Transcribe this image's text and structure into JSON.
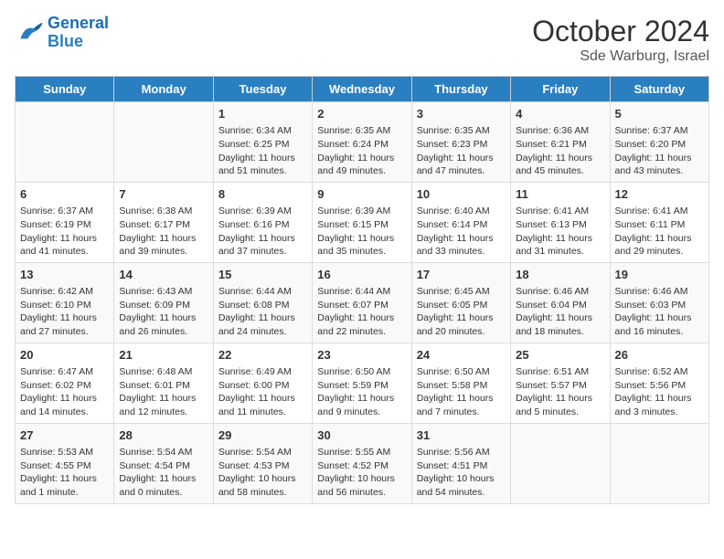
{
  "logo": {
    "text_general": "General",
    "text_blue": "Blue"
  },
  "header": {
    "month": "October 2024",
    "location": "Sde Warburg, Israel"
  },
  "days_of_week": [
    "Sunday",
    "Monday",
    "Tuesday",
    "Wednesday",
    "Thursday",
    "Friday",
    "Saturday"
  ],
  "weeks": [
    [
      {
        "day": "",
        "info": ""
      },
      {
        "day": "",
        "info": ""
      },
      {
        "day": "1",
        "info": "Sunrise: 6:34 AM\nSunset: 6:25 PM\nDaylight: 11 hours and 51 minutes."
      },
      {
        "day": "2",
        "info": "Sunrise: 6:35 AM\nSunset: 6:24 PM\nDaylight: 11 hours and 49 minutes."
      },
      {
        "day": "3",
        "info": "Sunrise: 6:35 AM\nSunset: 6:23 PM\nDaylight: 11 hours and 47 minutes."
      },
      {
        "day": "4",
        "info": "Sunrise: 6:36 AM\nSunset: 6:21 PM\nDaylight: 11 hours and 45 minutes."
      },
      {
        "day": "5",
        "info": "Sunrise: 6:37 AM\nSunset: 6:20 PM\nDaylight: 11 hours and 43 minutes."
      }
    ],
    [
      {
        "day": "6",
        "info": "Sunrise: 6:37 AM\nSunset: 6:19 PM\nDaylight: 11 hours and 41 minutes."
      },
      {
        "day": "7",
        "info": "Sunrise: 6:38 AM\nSunset: 6:17 PM\nDaylight: 11 hours and 39 minutes."
      },
      {
        "day": "8",
        "info": "Sunrise: 6:39 AM\nSunset: 6:16 PM\nDaylight: 11 hours and 37 minutes."
      },
      {
        "day": "9",
        "info": "Sunrise: 6:39 AM\nSunset: 6:15 PM\nDaylight: 11 hours and 35 minutes."
      },
      {
        "day": "10",
        "info": "Sunrise: 6:40 AM\nSunset: 6:14 PM\nDaylight: 11 hours and 33 minutes."
      },
      {
        "day": "11",
        "info": "Sunrise: 6:41 AM\nSunset: 6:13 PM\nDaylight: 11 hours and 31 minutes."
      },
      {
        "day": "12",
        "info": "Sunrise: 6:41 AM\nSunset: 6:11 PM\nDaylight: 11 hours and 29 minutes."
      }
    ],
    [
      {
        "day": "13",
        "info": "Sunrise: 6:42 AM\nSunset: 6:10 PM\nDaylight: 11 hours and 27 minutes."
      },
      {
        "day": "14",
        "info": "Sunrise: 6:43 AM\nSunset: 6:09 PM\nDaylight: 11 hours and 26 minutes."
      },
      {
        "day": "15",
        "info": "Sunrise: 6:44 AM\nSunset: 6:08 PM\nDaylight: 11 hours and 24 minutes."
      },
      {
        "day": "16",
        "info": "Sunrise: 6:44 AM\nSunset: 6:07 PM\nDaylight: 11 hours and 22 minutes."
      },
      {
        "day": "17",
        "info": "Sunrise: 6:45 AM\nSunset: 6:05 PM\nDaylight: 11 hours and 20 minutes."
      },
      {
        "day": "18",
        "info": "Sunrise: 6:46 AM\nSunset: 6:04 PM\nDaylight: 11 hours and 18 minutes."
      },
      {
        "day": "19",
        "info": "Sunrise: 6:46 AM\nSunset: 6:03 PM\nDaylight: 11 hours and 16 minutes."
      }
    ],
    [
      {
        "day": "20",
        "info": "Sunrise: 6:47 AM\nSunset: 6:02 PM\nDaylight: 11 hours and 14 minutes."
      },
      {
        "day": "21",
        "info": "Sunrise: 6:48 AM\nSunset: 6:01 PM\nDaylight: 11 hours and 12 minutes."
      },
      {
        "day": "22",
        "info": "Sunrise: 6:49 AM\nSunset: 6:00 PM\nDaylight: 11 hours and 11 minutes."
      },
      {
        "day": "23",
        "info": "Sunrise: 6:50 AM\nSunset: 5:59 PM\nDaylight: 11 hours and 9 minutes."
      },
      {
        "day": "24",
        "info": "Sunrise: 6:50 AM\nSunset: 5:58 PM\nDaylight: 11 hours and 7 minutes."
      },
      {
        "day": "25",
        "info": "Sunrise: 6:51 AM\nSunset: 5:57 PM\nDaylight: 11 hours and 5 minutes."
      },
      {
        "day": "26",
        "info": "Sunrise: 6:52 AM\nSunset: 5:56 PM\nDaylight: 11 hours and 3 minutes."
      }
    ],
    [
      {
        "day": "27",
        "info": "Sunrise: 5:53 AM\nSunset: 4:55 PM\nDaylight: 11 hours and 1 minute."
      },
      {
        "day": "28",
        "info": "Sunrise: 5:54 AM\nSunset: 4:54 PM\nDaylight: 11 hours and 0 minutes."
      },
      {
        "day": "29",
        "info": "Sunrise: 5:54 AM\nSunset: 4:53 PM\nDaylight: 10 hours and 58 minutes."
      },
      {
        "day": "30",
        "info": "Sunrise: 5:55 AM\nSunset: 4:52 PM\nDaylight: 10 hours and 56 minutes."
      },
      {
        "day": "31",
        "info": "Sunrise: 5:56 AM\nSunset: 4:51 PM\nDaylight: 10 hours and 54 minutes."
      },
      {
        "day": "",
        "info": ""
      },
      {
        "day": "",
        "info": ""
      }
    ]
  ]
}
